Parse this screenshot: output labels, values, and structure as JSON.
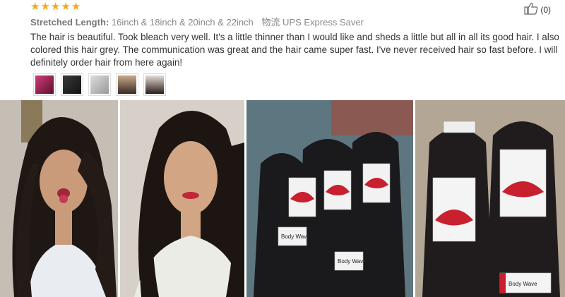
{
  "rating": {
    "stars": 5,
    "color": "#f5a623"
  },
  "meta": {
    "label": "Stretched Length:",
    "value": "16inch & 18inch & 20inch & 22inch",
    "shipping_label": "物流",
    "shipping": "UPS Express Saver"
  },
  "helpful": {
    "count": "(0)"
  },
  "review": {
    "text": "The hair is beautiful. Took bleach very well. It's a little thinner than I would like and sheds a little but all in all its good hair. I also colored this hair grey. The communication was great and the hair came super fast. I've never received hair so fast before. I will definitely order hair from here again!"
  },
  "thumbnails": [
    {
      "icon": "product-thumbnail"
    },
    {
      "icon": "hair-thumbnail"
    },
    {
      "icon": "hair-bundles-thumbnail"
    },
    {
      "icon": "model-thumbnail"
    },
    {
      "icon": "model-thumbnail"
    }
  ],
  "photos": {
    "tag_label": "Body Wave"
  }
}
